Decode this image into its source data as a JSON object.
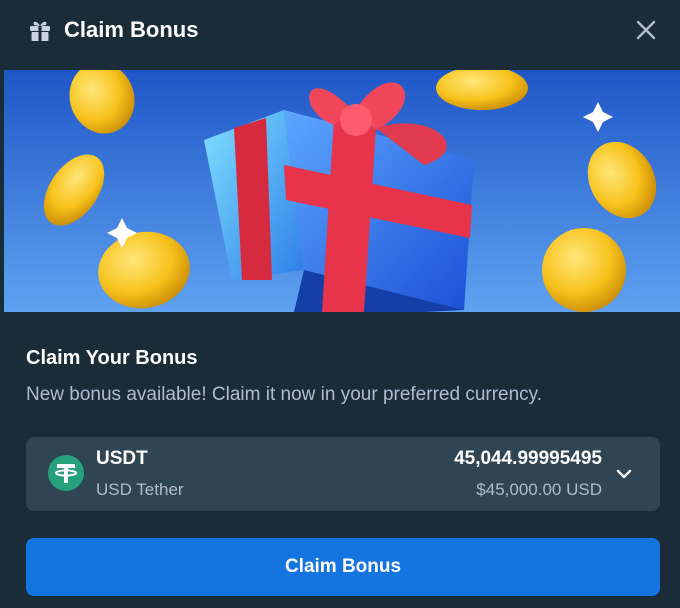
{
  "header": {
    "title": "Claim Bonus",
    "icon": "gift-icon",
    "close_icon": "close-icon"
  },
  "banner": {
    "description_icons": [
      "gift-box",
      "gold-coin",
      "sparkle"
    ]
  },
  "content": {
    "title": "Claim Your Bonus",
    "description": "New bonus available! Claim it now in your preferred currency."
  },
  "currency": {
    "code": "USDT",
    "name": "USD Tether",
    "amount": "45,044.99995495",
    "fiat_value": "$45,000.00 USD",
    "icon": "tether-icon",
    "icon_color": "#26a17b"
  },
  "actions": {
    "claim_label": "Claim Bonus"
  },
  "colors": {
    "modal_bg": "#1a2c38",
    "select_bg": "#2f4553",
    "accent": "#1475e1",
    "muted_text": "#b1bad3"
  }
}
